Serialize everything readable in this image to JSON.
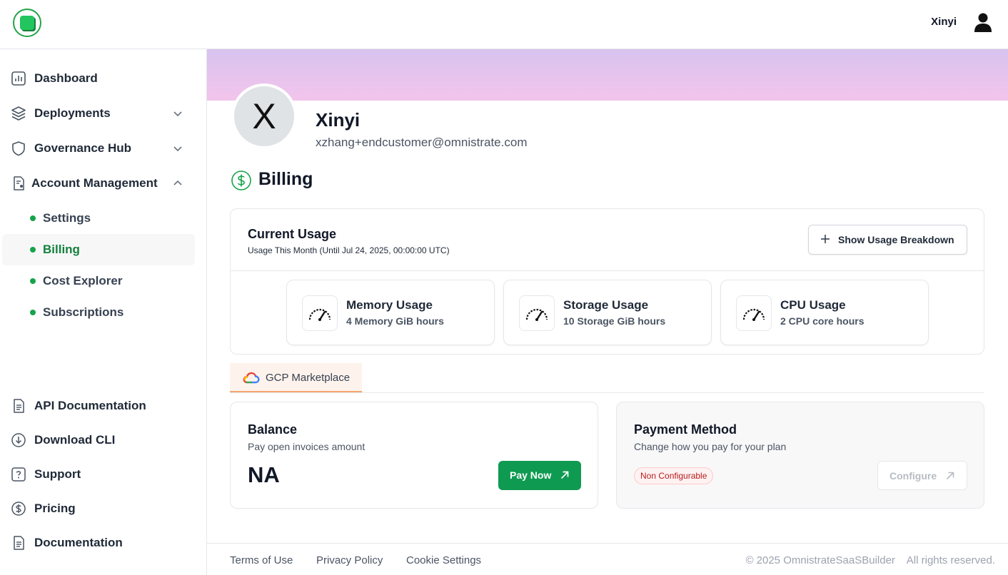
{
  "header": {
    "user_name": "Xinyi",
    "logo_icon": "omnistrate-logo-icon",
    "avatar_icon": "user-avatar-icon"
  },
  "sidebar": {
    "items": [
      {
        "label": "Dashboard",
        "icon": "chart-icon"
      },
      {
        "label": "Deployments",
        "icon": "layers-icon",
        "expandable": true,
        "expanded": false
      },
      {
        "label": "Governance Hub",
        "icon": "shield-icon",
        "expandable": true,
        "expanded": false
      },
      {
        "label": "Account Management",
        "icon": "document-user-icon",
        "expandable": true,
        "expanded": true
      }
    ],
    "sub_items": [
      {
        "label": "Settings",
        "active": false
      },
      {
        "label": "Billing",
        "active": true
      },
      {
        "label": "Cost Explorer",
        "active": false
      },
      {
        "label": "Subscriptions",
        "active": false
      }
    ],
    "bottom_items": [
      {
        "label": "API Documentation",
        "icon": "document-icon"
      },
      {
        "label": "Download CLI",
        "icon": "download-icon"
      },
      {
        "label": "Support",
        "icon": "help-icon"
      },
      {
        "label": "Pricing",
        "icon": "dollar-icon"
      },
      {
        "label": "Documentation",
        "icon": "document-icon"
      }
    ]
  },
  "profile": {
    "initial": "X",
    "name": "Xinyi",
    "email": "xzhang+endcustomer@omnistrate.com"
  },
  "billing": {
    "title": "Billing",
    "usage": {
      "title": "Current Usage",
      "subtitle": "Usage This Month (Until Jul 24, 2025, 00:00:00 UTC)",
      "breakdown_label": "Show Usage Breakdown",
      "metrics": [
        {
          "title": "Memory Usage",
          "value": "4 Memory GiB hours"
        },
        {
          "title": "Storage Usage",
          "value": "10 Storage GiB hours"
        },
        {
          "title": "CPU Usage",
          "value": "2 CPU core hours"
        }
      ]
    },
    "tab": {
      "label": "GCP Marketplace"
    },
    "balance": {
      "title": "Balance",
      "subtitle": "Pay open invoices amount",
      "value": "NA",
      "pay_label": "Pay Now"
    },
    "payment": {
      "title": "Payment Method",
      "subtitle": "Change how you pay for your plan",
      "badge": "Non Configurable",
      "configure_label": "Configure"
    }
  },
  "footer": {
    "links": [
      "Terms of Use",
      "Privacy Policy",
      "Cookie Settings"
    ],
    "copyright": "© 2025 OmnistrateSaaSBuilder    All rights reserved."
  },
  "colors": {
    "accent": "#0f9a52",
    "active_text": "#15803d",
    "badge_red": "#b91c1c",
    "banner_top": "#d7c3ef",
    "banner_bottom": "#f3c4ec"
  }
}
